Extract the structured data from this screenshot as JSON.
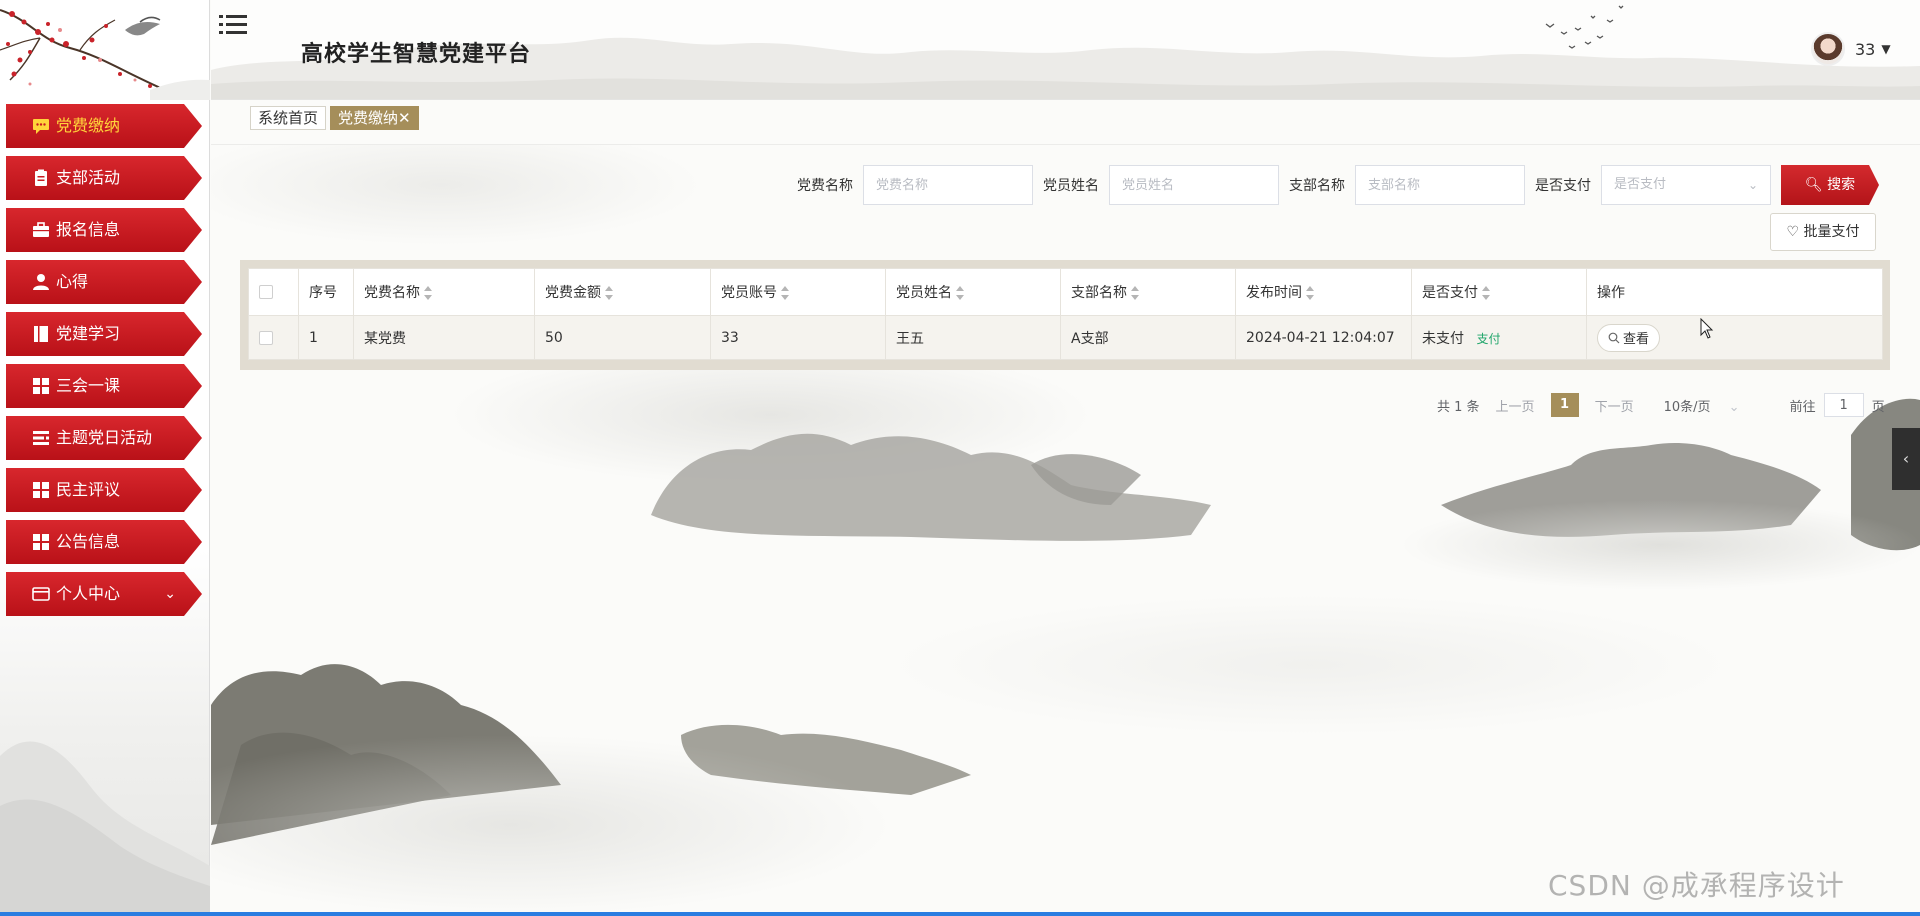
{
  "header": {
    "title": "高校学生智慧党建平台",
    "user_name": "33"
  },
  "sidebar": {
    "items": [
      {
        "label": "党费缴纳",
        "icon": "chat-icon",
        "active": true
      },
      {
        "label": "支部活动",
        "icon": "clipboard-icon"
      },
      {
        "label": "报名信息",
        "icon": "briefcase-icon"
      },
      {
        "label": "心得",
        "icon": "user-icon"
      },
      {
        "label": "党建学习",
        "icon": "book-icon"
      },
      {
        "label": "三会一课",
        "icon": "grid-icon"
      },
      {
        "label": "主题党日活动",
        "icon": "list-icon"
      },
      {
        "label": "民主评议",
        "icon": "grid-icon"
      },
      {
        "label": "公告信息",
        "icon": "grid-icon"
      },
      {
        "label": "个人中心",
        "icon": "card-icon",
        "expandable": true
      }
    ]
  },
  "tabs": [
    {
      "label": "系统首页"
    },
    {
      "label": "党费缴纳✕",
      "active": true
    }
  ],
  "search": {
    "fee_name_label": "党费名称",
    "fee_name_placeholder": "党费名称",
    "member_name_label": "党员姓名",
    "member_name_placeholder": "党员姓名",
    "branch_label": "支部名称",
    "branch_placeholder": "支部名称",
    "paid_label": "是否支付",
    "paid_placeholder": "是否支付",
    "search_button": "搜索",
    "batch_pay_button": "批量支付"
  },
  "table": {
    "headers": [
      "序号",
      "党费名称",
      "党费金额",
      "党员账号",
      "党员姓名",
      "支部名称",
      "发布时间",
      "是否支付",
      "操作"
    ],
    "rows": [
      {
        "index": "1",
        "fee_name": "某党费",
        "amount": "50",
        "account": "33",
        "member_name": "王五",
        "branch": "A支部",
        "publish_time": "2024-04-21 12:04:07",
        "paid_status": "未支付",
        "pay_link": "支付",
        "view_button": "查看"
      }
    ]
  },
  "pagination": {
    "total": "共 1 条",
    "prev": "上一页",
    "current_page": "1",
    "next": "下一页",
    "page_size": "10条/页",
    "goto_label": "前往",
    "goto_value": "1",
    "page_suffix": "页"
  },
  "watermark": "CSDN @成承程序设计",
  "colors": {
    "menu_red": "#c81c22",
    "active_tab_gold": "#a58e5a",
    "pay_link_green": "#1fa56a",
    "active_menu_text": "#ffd43a"
  }
}
